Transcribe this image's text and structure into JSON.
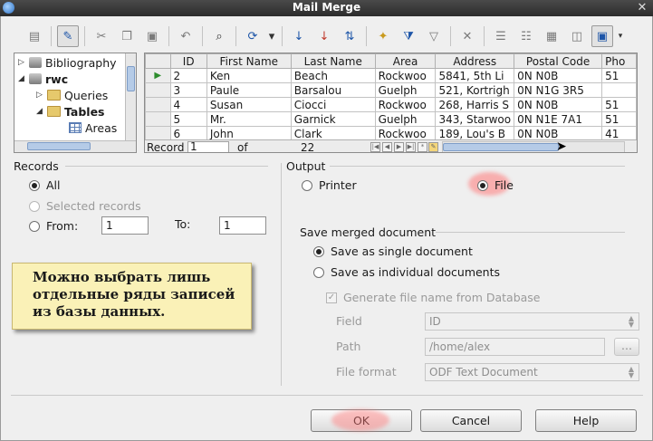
{
  "window": {
    "title": "Mail Merge",
    "close_glyph": "✕"
  },
  "toolbar": {
    "icons": [
      "save-icon",
      "edit-icon",
      "cut-icon",
      "copy-icon",
      "paste-icon",
      "undo-icon",
      "find-icon",
      "refresh-icon",
      "dropdown-arrow",
      "sort-ascending-icon",
      "sort-descending-icon",
      "autofilter-icon",
      "standard-filter-icon",
      "apply-filter-icon",
      "remove-filter-icon",
      "data-to-text-icon",
      "data-to-fields-icon",
      "mail-merge-icon",
      "data-source-icon",
      "explorer-icon"
    ]
  },
  "tree": {
    "items": [
      {
        "label": "Bibliography",
        "icon": "database-icon"
      },
      {
        "label": "rwc",
        "icon": "database-icon"
      },
      {
        "label": "Queries",
        "icon": "folder-icon"
      },
      {
        "label": "Tables",
        "icon": "folder-icon"
      },
      {
        "label": "Areas",
        "icon": "table-icon"
      }
    ]
  },
  "grid": {
    "columns": [
      "ID",
      "First Name",
      "Last Name",
      "Area",
      "Address",
      "Postal Code",
      "Pho"
    ],
    "rows": [
      [
        "2",
        "Ken",
        "Beach",
        "Rockwoo",
        "5841, 5th Li",
        "0N N0B",
        "51"
      ],
      [
        "3",
        "Paule",
        "Barsalou",
        "Guelph",
        "521, Kortrigh",
        "0N N1G 3R5",
        ""
      ],
      [
        "4",
        "Susan",
        "Ciocci",
        "Rockwoo",
        "268, Harris S",
        "0N N0B",
        "51"
      ],
      [
        "5",
        "Mr.",
        "Garnick",
        "Guelph",
        "343, Starwoo",
        "0N N1E 7A1",
        "51"
      ],
      [
        "6",
        "John",
        "Clark",
        "Rockwoo",
        "189, Lou's B",
        "0N N0B",
        "41"
      ]
    ],
    "record_label": "Record",
    "record_value": "1",
    "of_label": "of",
    "total_value": "22",
    "current_row_marker": "▶"
  },
  "records": {
    "title": "Records",
    "all_label": "All",
    "selected_label": "Selected records",
    "from_label": "From:",
    "from_value": "1",
    "to_label": "To:",
    "to_value": "1",
    "selected_option": "All"
  },
  "output": {
    "title": "Output",
    "printer_label": "Printer",
    "file_label": "File",
    "selected_option": "File"
  },
  "save_merged": {
    "title": "Save merged document",
    "single_label": "Save as single document",
    "individual_label": "Save as individual documents",
    "selected_option": "Save as single document",
    "generate_label": "Generate file name from Database",
    "field_label": "Field",
    "field_value": "ID",
    "path_label": "Path",
    "path_value": "/home/alex",
    "browse_label": "...",
    "file_format_label": "File format",
    "file_format_value": "ODF Text Document"
  },
  "note": {
    "text": "Можно выбрать лишь отдельные ряды записей из базы данных."
  },
  "buttons": {
    "ok": "OK",
    "cancel": "Cancel",
    "help": "Help"
  },
  "colors": {
    "highlight": "#ff7878",
    "note_bg": "#faf1b7",
    "selection_blue": "#b5cbe7"
  }
}
